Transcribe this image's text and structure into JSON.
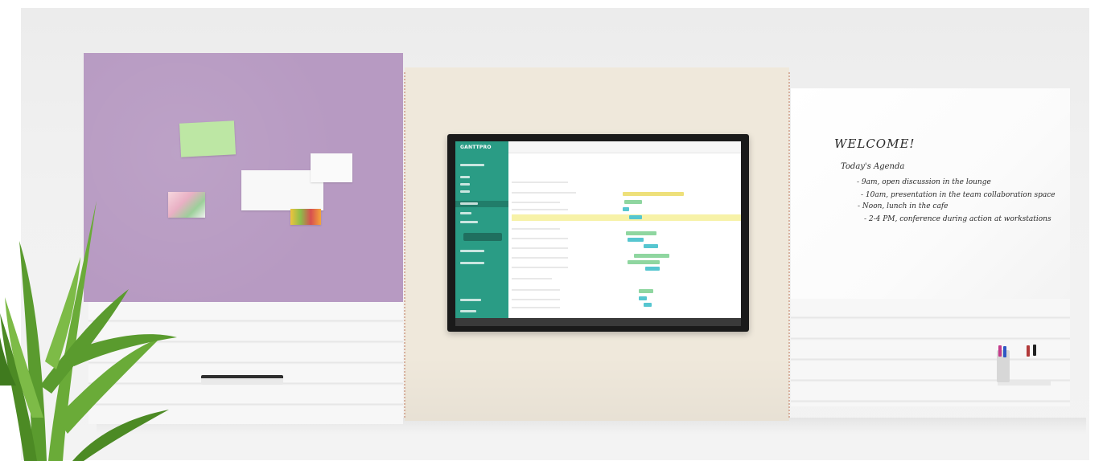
{
  "scene": {
    "description_tag": "office-wall-modular-panels"
  },
  "tv_app": {
    "logo_text": "GANTTPRO"
  },
  "whiteboard": {
    "title": "WELCOME!",
    "subtitle": "Today's Agenda",
    "lines": [
      "- 9am, open discussion in the lounge",
      "- 10am, presentation in the team collaboration space",
      "- Noon, lunch in the cafe",
      "- 2-4 PM, conference during action at workstations"
    ]
  },
  "colors": {
    "felt": "#b79ac2",
    "center_panel": "#efe8db",
    "app_sidebar": "#2a9c85",
    "gantt_yellow": "#eee07a",
    "gantt_teal": "#56c6d0",
    "gantt_green": "#8fd6a0"
  },
  "icons": [
    "plant-icon",
    "marker-icon",
    "tablet-icon"
  ]
}
